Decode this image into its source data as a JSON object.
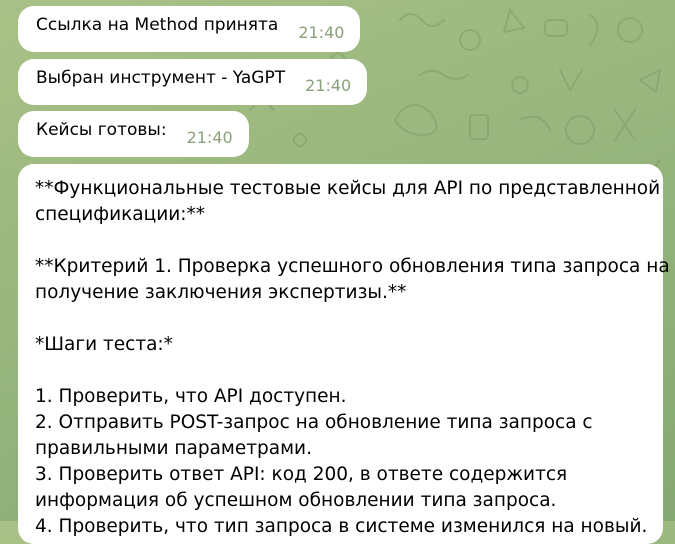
{
  "theme": {
    "wallpaper": "#9bb87f",
    "bubble": "#ffffff",
    "time_color": "#8aa27a"
  },
  "messages": [
    {
      "text": "Ссылка на Method принята",
      "time": "21:40"
    },
    {
      "text": "Выбран инструмент - YaGPT",
      "time": "21:40"
    },
    {
      "text": "Кейсы готовы:",
      "time": "21:40"
    }
  ],
  "long_message": {
    "lines": [
      "**Функциональные тестовые кейсы для API по представленной",
      "спецификации:**",
      "",
      "**Критерий 1. Проверка успешного обновления типа запроса на",
      "получение заключения экспертизы.**",
      "",
      "*Шаги теста:*",
      "",
      "1. Проверить, что API доступен.",
      "2. Отправить POST-запрос на обновление типа запроса с",
      "правильными параметрами.",
      "3. Проверить ответ API: код 200, в ответе содержится",
      "информация об успешном обновлении типа запроса.",
      "4. Проверить, что тип запроса в системе изменился на новый."
    ]
  }
}
